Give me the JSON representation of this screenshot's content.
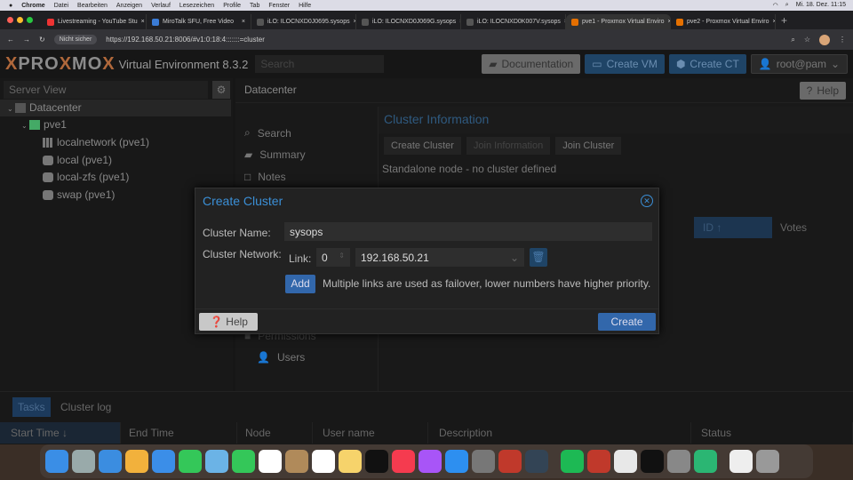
{
  "menubar": {
    "app": "Chrome",
    "items": [
      "Datei",
      "Bearbeiten",
      "Anzeigen",
      "Verlauf",
      "Lesezeichen",
      "Profile",
      "Tab",
      "Fenster",
      "Hilfe"
    ],
    "clock": "Mi. 18. Dez. 11:15"
  },
  "tabs": [
    {
      "label": "Livestreaming - YouTube Stu",
      "color": "#e33"
    },
    {
      "label": "MiroTalk SFU, Free Video",
      "color": "#3a7bd5"
    },
    {
      "label": "iLO: ILOCNXD0J0695.sysops",
      "color": "#555"
    },
    {
      "label": "iLO: ILOCNXD0J069G.sysops",
      "color": "#555"
    },
    {
      "label": "iLO: ILOCNXD0K007V.sysops",
      "color": "#555"
    },
    {
      "label": "pve1 - Proxmox Virtual Enviro",
      "color": "#e57000",
      "active": true
    },
    {
      "label": "pve2 - Proxmox Virtual Enviro",
      "color": "#e57000"
    }
  ],
  "address": {
    "security": "Nicht sicher",
    "url": "https://192.168.50.21:8006/#v1:0:18:4:::::::=cluster"
  },
  "header": {
    "logo": "PROXMOX",
    "version": "Virtual Environment 8.3.2",
    "search_placeholder": "Search",
    "documentation": "Documentation",
    "create_vm": "Create VM",
    "create_ct": "Create CT",
    "user": "root@pam"
  },
  "tree": {
    "view": "Server View",
    "items": [
      {
        "label": "Datacenter",
        "icon": "datacenter-icon"
      },
      {
        "label": "pve1",
        "icon": "node-online-icon"
      },
      {
        "label": "localnetwork (pve1)",
        "icon": "sdn-grid-icon"
      },
      {
        "label": "local (pve1)",
        "icon": "storage-icon"
      },
      {
        "label": "local-zfs (pve1)",
        "icon": "storage-icon"
      },
      {
        "label": "swap (pve1)",
        "icon": "storage-icon"
      }
    ]
  },
  "content": {
    "title": "Datacenter",
    "help": "Help",
    "nav": [
      "Search",
      "Summary",
      "Notes",
      "Permissions",
      "Users"
    ],
    "cluster_info": "Cluster Information",
    "create_cluster": "Create Cluster",
    "join_information": "Join Information",
    "join_cluster": "Join Cluster",
    "standalone": "Standalone node - no cluster defined",
    "col_id": "ID ↑",
    "col_votes": "Votes"
  },
  "dialog": {
    "title": "Create Cluster",
    "name_label": "Cluster Name:",
    "name_value": "sysops",
    "network_label": "Cluster Network:",
    "link_label": "Link:",
    "link_value": "0",
    "ip_value": "192.168.50.21",
    "add": "Add",
    "hint": "Multiple links are used as failover, lower numbers have higher priority.",
    "help": "Help",
    "create": "Create"
  },
  "bottom": {
    "tabs": [
      "Tasks",
      "Cluster log"
    ],
    "columns": [
      "Start Time ↓",
      "End Time",
      "Node",
      "User name",
      "Description",
      "Status"
    ]
  },
  "dock": {
    "colors": [
      "#3a8ee6",
      "#9aa",
      "#3b8de0",
      "#f2b13c",
      "#3b8ee8",
      "#34c759",
      "#6bb3e6",
      "#34c759",
      "#fff",
      "#b08a5a",
      "#fff",
      "#f6d36b",
      "#111",
      "#f53b4f",
      "#a855f7",
      "#2d8ff0",
      "#777",
      "#c0392b",
      "#345",
      "#1db954",
      "#c0392b",
      "#e8e8e8",
      "#111",
      "#888",
      "#2bb673",
      "#eee",
      "#999"
    ]
  }
}
